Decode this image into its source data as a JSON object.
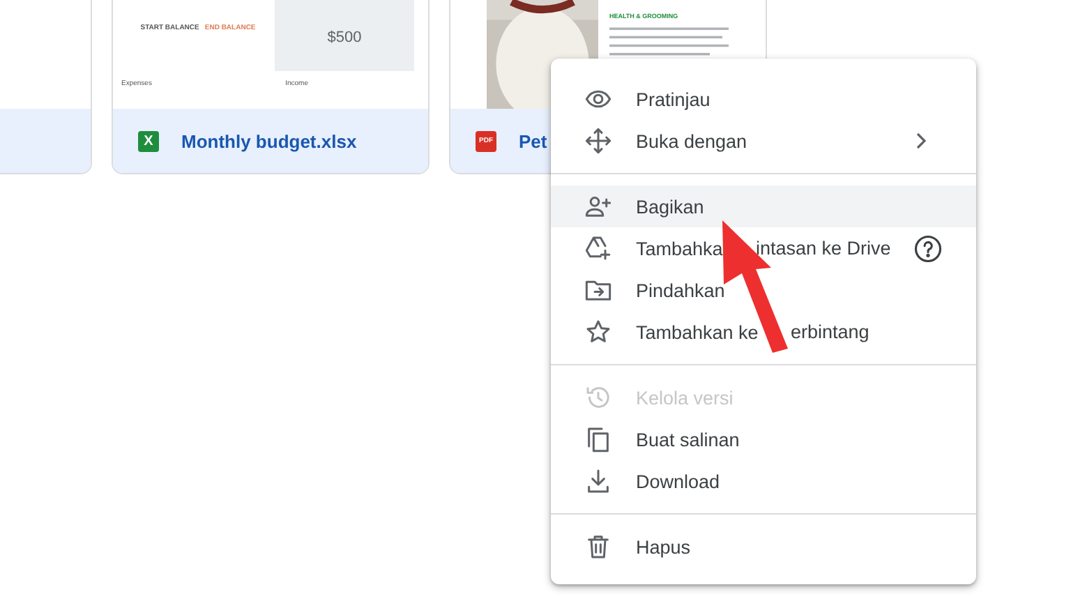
{
  "files": [
    {
      "kind": "document"
    },
    {
      "kind": "sheet",
      "name": "Monthly budget.xlsx",
      "badge": "X",
      "thumbnail": {
        "amount": "$500",
        "start": "START BALANCE",
        "end": "END BALANCE",
        "left_heading": "Expenses",
        "right_heading": "Income"
      }
    },
    {
      "kind": "pdf",
      "name": "Pet",
      "badge": "PDF",
      "thumbnail": {
        "heading": "HEALTH & GROOMING"
      }
    }
  ],
  "context_menu": {
    "groups": [
      [
        {
          "label": "Pratinjau",
          "disabled": false,
          "highlighted": false,
          "submenu": false,
          "help": false
        },
        {
          "label": "Buka dengan",
          "disabled": false,
          "highlighted": false,
          "submenu": true,
          "help": false
        }
      ],
      [
        {
          "label": "Bagikan",
          "disabled": false,
          "highlighted": true,
          "submenu": false,
          "help": false
        },
        {
          "label": "Tambahka",
          "label_after": "intasan ke Drive",
          "disabled": false,
          "highlighted": false,
          "submenu": false,
          "help": true
        },
        {
          "label": "Pindahkan",
          "disabled": false,
          "highlighted": false,
          "submenu": false,
          "help": false
        },
        {
          "label": "Tambahkan ke",
          "label_after": "erbintang",
          "disabled": false,
          "highlighted": false,
          "submenu": false,
          "help": false
        }
      ],
      [
        {
          "label": "Kelola versi",
          "disabled": true,
          "highlighted": false,
          "submenu": false,
          "help": false
        },
        {
          "label": "Buat salinan",
          "disabled": false,
          "highlighted": false,
          "submenu": false,
          "help": false
        },
        {
          "label": "Download",
          "disabled": false,
          "highlighted": false,
          "submenu": false,
          "help": false
        }
      ],
      [
        {
          "label": "Hapus",
          "disabled": false,
          "highlighted": false,
          "submenu": false,
          "help": false
        }
      ]
    ]
  },
  "pointer_arrow": {
    "shown": true
  }
}
